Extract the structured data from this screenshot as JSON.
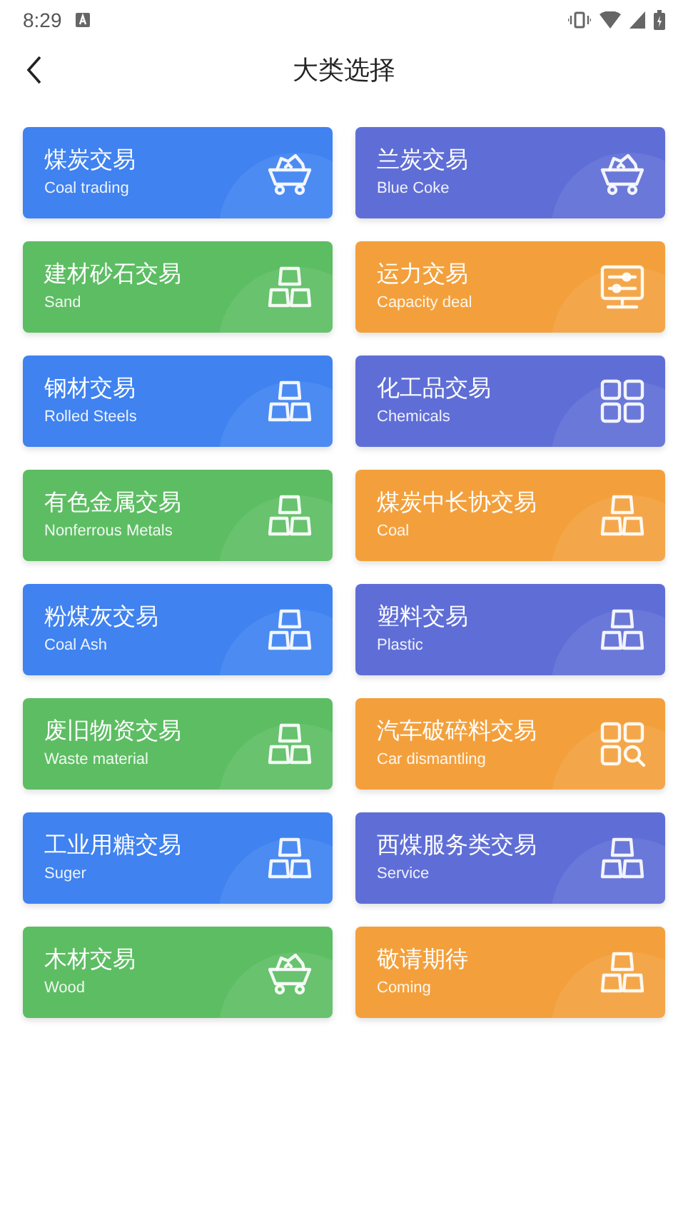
{
  "status_bar": {
    "time": "8:29"
  },
  "header": {
    "title": "大类选择"
  },
  "categories": [
    {
      "name": "煤炭交易",
      "subtitle": "Coal trading",
      "color": "#3f82f0",
      "kind": "cart"
    },
    {
      "name": "兰炭交易",
      "subtitle": "Blue Coke",
      "color": "#5f6ed6",
      "kind": "cart"
    },
    {
      "name": "建材砂石交易",
      "subtitle": "Sand",
      "color": "#5dbd63",
      "kind": "bars"
    },
    {
      "name": "运力交易",
      "subtitle": "Capacity deal",
      "color": "#f3a03c",
      "kind": "monitor"
    },
    {
      "name": "钢材交易",
      "subtitle": "Rolled Steels",
      "color": "#3f82f0",
      "kind": "bars"
    },
    {
      "name": "化工品交易",
      "subtitle": "Chemicals",
      "color": "#5f6ed6",
      "kind": "grid"
    },
    {
      "name": "有色金属交易",
      "subtitle": "Nonferrous Metals",
      "color": "#5dbd63",
      "kind": "bars"
    },
    {
      "name": "煤炭中长协交易",
      "subtitle": "Coal",
      "color": "#f3a03c",
      "kind": "bars"
    },
    {
      "name": "粉煤灰交易",
      "subtitle": "Coal Ash",
      "color": "#3f82f0",
      "kind": "bars"
    },
    {
      "name": "塑料交易",
      "subtitle": "Plastic",
      "color": "#5f6ed6",
      "kind": "bars"
    },
    {
      "name": "废旧物资交易",
      "subtitle": "Waste material",
      "color": "#5dbd63",
      "kind": "bars"
    },
    {
      "name": "汽车破碎料交易",
      "subtitle": "Car dismantling",
      "color": "#f3a03c",
      "kind": "grid-search"
    },
    {
      "name": "工业用糖交易",
      "subtitle": "Suger",
      "color": "#3f82f0",
      "kind": "bars"
    },
    {
      "name": "西煤服务类交易",
      "subtitle": "Service",
      "color": "#5f6ed6",
      "kind": "bars"
    },
    {
      "name": "木材交易",
      "subtitle": "Wood",
      "color": "#5dbd63",
      "kind": "cart"
    },
    {
      "name": "敬请期待",
      "subtitle": "Coming",
      "color": "#f3a03c",
      "kind": "bars"
    }
  ]
}
